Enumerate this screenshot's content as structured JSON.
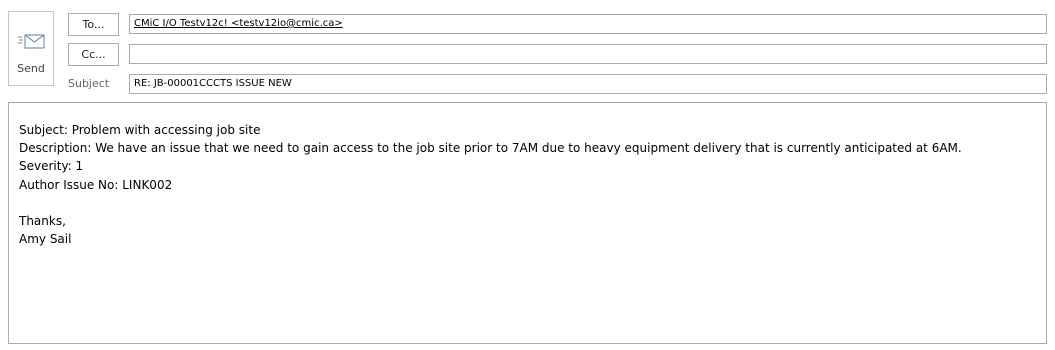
{
  "toolbar": {
    "send_label": "Send",
    "send_icon": "envelope-send-icon"
  },
  "header": {
    "to_label": "To...",
    "cc_label": "Cc...",
    "subject_label": "Subject",
    "to_value": "CMiC I/O Testv12c! <testv12io@cmic.ca>",
    "cc_value": "",
    "subject_value": "RE: JB-00001CCCTS ISSUE NEW"
  },
  "body": {
    "lines": [
      "Subject: Problem with accessing job site",
      "Description: We have an issue that we need to gain access to the job site prior to 7AM due to heavy equipment delivery that is currently anticipated at 6AM.",
      "Severity: 1",
      "Author Issue No: LINK002",
      "",
      "Thanks,",
      "Amy Sail"
    ]
  }
}
